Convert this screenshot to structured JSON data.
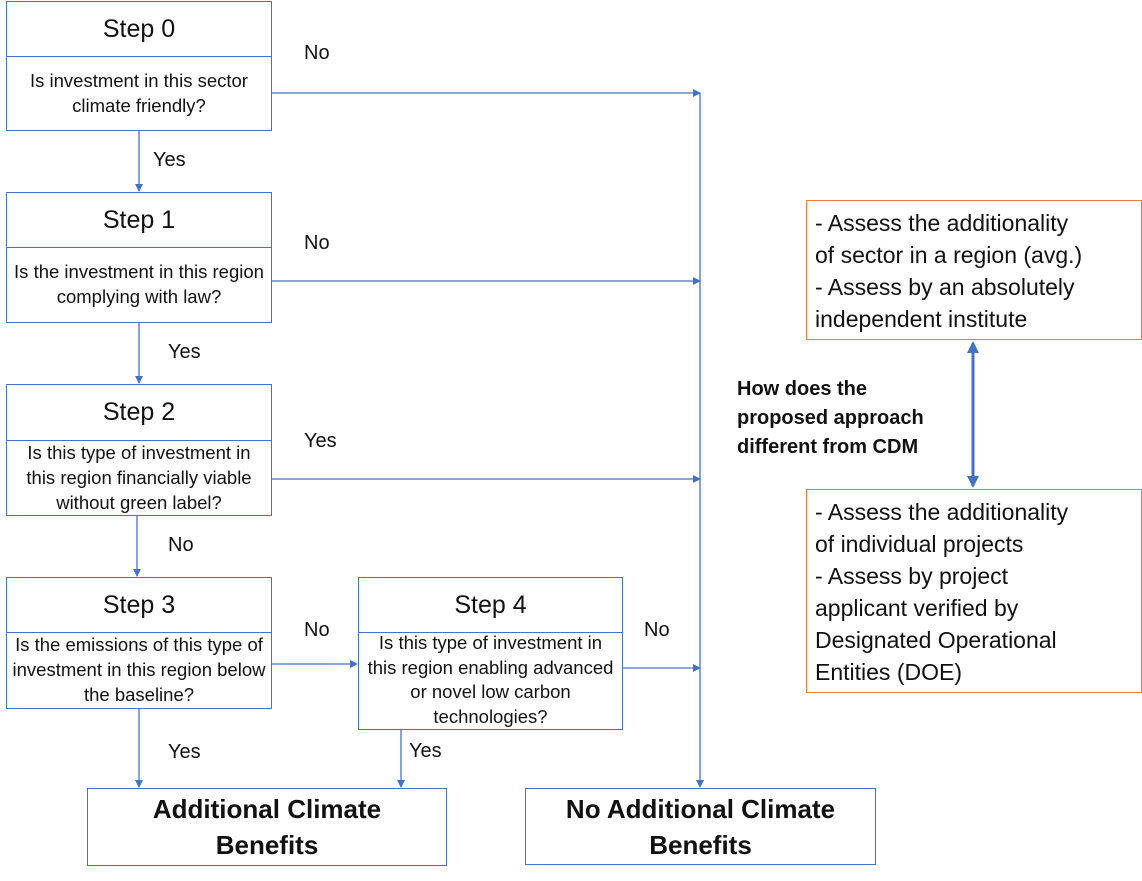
{
  "steps": [
    {
      "title": "Step 0",
      "question": "Is investment in this sector climate friendly?"
    },
    {
      "title": "Step 1",
      "question": "Is the investment in this region complying with law?"
    },
    {
      "title": "Step 2",
      "question": "Is this type of investment in this region financially viable without green label?"
    },
    {
      "title": "Step 3",
      "question": "Is the emissions of this type of investment in this region below the baseline?"
    },
    {
      "title": "Step 4",
      "question": "Is this type of investment in this region enabling advanced or novel low carbon technologies?"
    }
  ],
  "edge_labels": {
    "step0_right": "No",
    "step0_down": "Yes",
    "step1_right": "No",
    "step1_down": "Yes",
    "step2_right": "Yes",
    "step2_down": "No",
    "step3_right": "No",
    "step3_down": "Yes",
    "step4_right": "No",
    "step4_down": "Yes"
  },
  "outcomes": {
    "additional": "Additional Climate Benefits",
    "no_additional": "No Additional Climate Benefits"
  },
  "comparison": {
    "question": "How does the proposed approach different from CDM",
    "proposed": [
      "- Assess the additionality",
      "of sector in a region (avg.)",
      "- Assess by an absolutely",
      "independent institute"
    ],
    "cdm": [
      "- Assess the additionality",
      "of individual projects",
      "- Assess by project",
      "applicant verified by",
      "Designated Operational",
      "Entities (DOE)"
    ]
  },
  "colors": {
    "flow_line": "#4472c4",
    "note_border": "#ed7d31"
  }
}
